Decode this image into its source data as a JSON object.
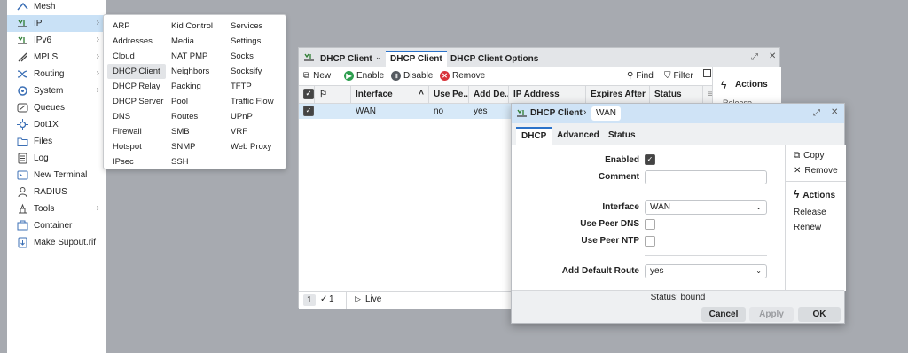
{
  "sidebar": {
    "items": [
      {
        "label": "Mesh",
        "icon": "mesh-icon",
        "arrow": false
      },
      {
        "label": "IP",
        "icon": "ip-icon",
        "arrow": true,
        "active": true
      },
      {
        "label": "IPv6",
        "icon": "ipv6-icon",
        "arrow": true
      },
      {
        "label": "MPLS",
        "icon": "mpls-icon",
        "arrow": true
      },
      {
        "label": "Routing",
        "icon": "routing-icon",
        "arrow": true
      },
      {
        "label": "System",
        "icon": "system-icon",
        "arrow": true
      },
      {
        "label": "Queues",
        "icon": "queues-icon",
        "arrow": false
      },
      {
        "label": "Dot1X",
        "icon": "dot1x-icon",
        "arrow": false
      },
      {
        "label": "Files",
        "icon": "folder-icon",
        "arrow": false
      },
      {
        "label": "Log",
        "icon": "log-icon",
        "arrow": false
      },
      {
        "label": "New Terminal",
        "icon": "terminal-icon",
        "arrow": false
      },
      {
        "label": "RADIUS",
        "icon": "radius-icon",
        "arrow": false
      },
      {
        "label": "Tools",
        "icon": "tools-icon",
        "arrow": true
      },
      {
        "label": "Container",
        "icon": "container-icon",
        "arrow": false
      },
      {
        "label": "Make Supout.rif",
        "icon": "supout-icon",
        "arrow": false
      }
    ],
    "arrow_glyph": "›"
  },
  "submenu": {
    "col1": [
      "ARP",
      "Addresses",
      "Cloud",
      "DHCP Client",
      "DHCP Relay",
      "DHCP Server",
      "DNS",
      "Firewall",
      "Hotspot",
      "IPsec"
    ],
    "col2": [
      "Kid Control",
      "Media",
      "NAT PMP",
      "Neighbors",
      "Packing",
      "Pool",
      "Routes",
      "SMB",
      "SNMP",
      "SSH"
    ],
    "col3": [
      "Services",
      "Settings",
      "Socks",
      "Socksify",
      "TFTP",
      "Traffic Flow",
      "UPnP",
      "VRF",
      "Web Proxy"
    ],
    "active": "DHCP Client"
  },
  "window": {
    "tabs": [
      "DHCP Client",
      "DHCP Client",
      "DHCP Client Options"
    ],
    "toolbar": {
      "new": "New",
      "enable": "Enable",
      "disable": "Disable",
      "remove": "Remove",
      "find": "Find",
      "filter": "Filter"
    },
    "actions_title": "Actions",
    "actions_partial": "Release",
    "columns": [
      "Interface",
      "Use Pe...",
      "Add De...",
      "IP Address",
      "Expires After",
      "Status"
    ],
    "rows": [
      {
        "interface": "WAN",
        "use_peer": "no",
        "add_default": "yes"
      }
    ],
    "status": {
      "page": "1",
      "count": "1",
      "live": "Live"
    }
  },
  "dialog": {
    "breadcrumb": [
      "DHCP Client",
      "WAN"
    ],
    "tabs": [
      "DHCP",
      "Advanced",
      "Status"
    ],
    "fields": {
      "enabled_label": "Enabled",
      "comment_label": "Comment",
      "interface_label": "Interface",
      "interface_value": "WAN",
      "use_peer_dns_label": "Use Peer DNS",
      "use_peer_ntp_label": "Use Peer NTP",
      "add_default_route_label": "Add Default Route",
      "add_default_route_value": "yes"
    },
    "side": {
      "copy": "Copy",
      "remove": "Remove",
      "actions": "Actions",
      "release": "Release",
      "renew": "Renew"
    },
    "status_text": "Status: bound",
    "buttons": {
      "cancel": "Cancel",
      "apply": "Apply",
      "ok": "OK"
    }
  },
  "colors": {
    "accent": "#2a72c9",
    "enable": "#2e9e4f",
    "disable": "#555a60",
    "remove": "#d8343a",
    "selection": "#d7e9f8"
  }
}
